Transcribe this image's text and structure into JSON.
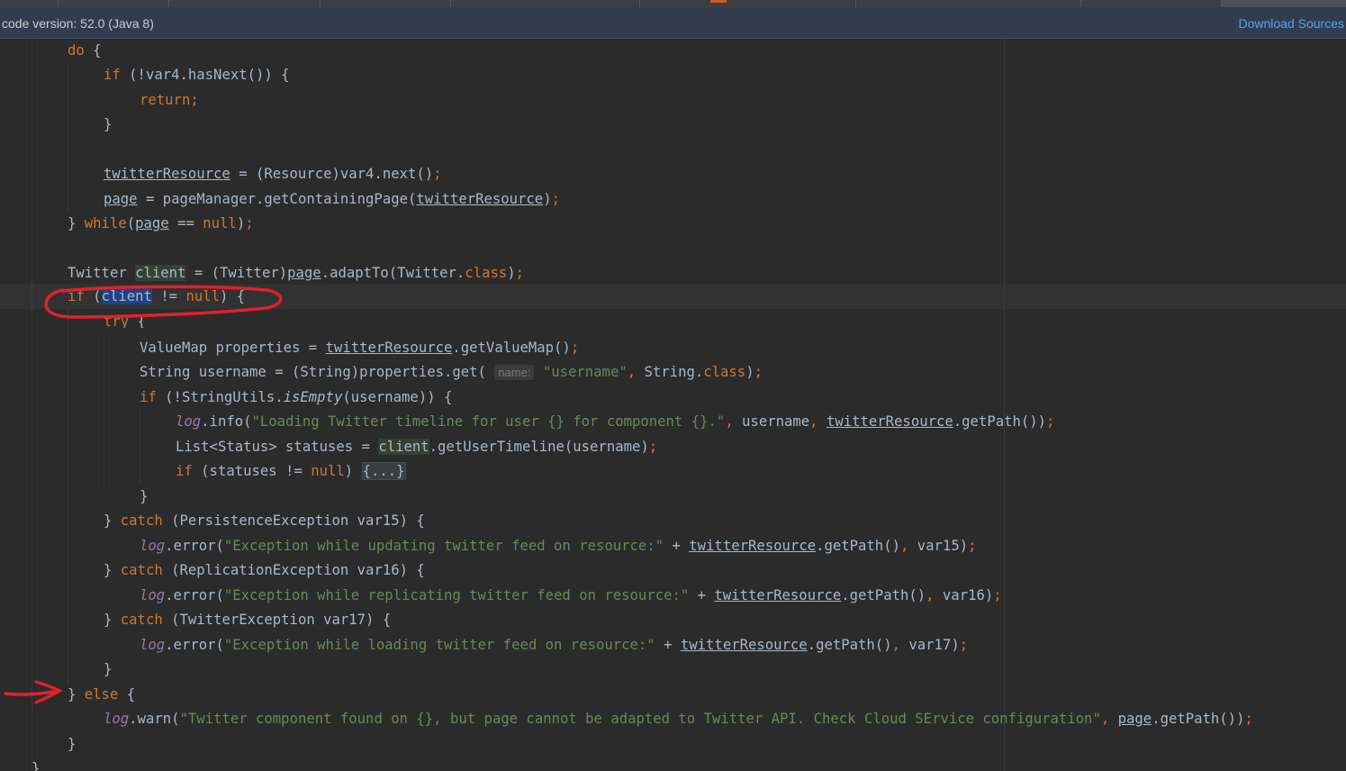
{
  "banner": {
    "message": "code version: 52.0 (Java 8)",
    "download_sources": "Download Sources"
  },
  "code": [
    {
      "t": "do {"
    },
    {
      "t": "if (!var4.hasNext()) {"
    },
    {
      "t": "return;"
    },
    {
      "t": "}"
    },
    {
      "t": ""
    },
    {
      "t": "twitterResource = (Resource)var4.next();"
    },
    {
      "t": "page = pageManager.getContainingPage(twitterResource);"
    },
    {
      "t": "} while(page == null);"
    },
    {
      "t": ""
    },
    {
      "t": "Twitter client = (Twitter)page.adaptTo(Twitter.class);"
    },
    {
      "t": "if (client != null) {"
    },
    {
      "t": "try {"
    },
    {
      "t": "ValueMap properties = twitterResource.getValueMap();"
    },
    {
      "t": "String username = (String)properties.get( name: \"username\", String.class);"
    },
    {
      "t": "if (!StringUtils.isEmpty(username)) {"
    },
    {
      "t": "log.info(\"Loading Twitter timeline for user {} for component {}.\", username, twitterResource.getPath());"
    },
    {
      "t": "List<Status> statuses = client.getUserTimeline(username);"
    },
    {
      "t": "if (statuses != null) {...}"
    },
    {
      "t": "}"
    },
    {
      "t": "} catch (PersistenceException var15) {"
    },
    {
      "t": "log.error(\"Exception while updating twitter feed on resource:\" + twitterResource.getPath(), var15);"
    },
    {
      "t": "} catch (ReplicationException var16) {"
    },
    {
      "t": "log.error(\"Exception while replicating twitter feed on resource:\" + twitterResource.getPath(), var16);"
    },
    {
      "t": "} catch (TwitterException var17) {"
    },
    {
      "t": "log.error(\"Exception while loading twitter feed on resource:\" + twitterResource.getPath(), var17);"
    },
    {
      "t": "}"
    },
    {
      "t": "} else {"
    },
    {
      "t": "log.warn(\"Twitter component found on {}, but page cannot be adapted to Twitter API. Check Cloud SErvice configuration\", page.getPath());"
    },
    {
      "t": "}"
    },
    {
      "t": "}"
    }
  ],
  "colors": {
    "background": "#2b2b2b",
    "keyword": "#cc7832",
    "string": "#6a8759",
    "field": "#9876aa",
    "text": "#a9b7c6",
    "annotation": "#e0202a",
    "link": "#589df6"
  }
}
